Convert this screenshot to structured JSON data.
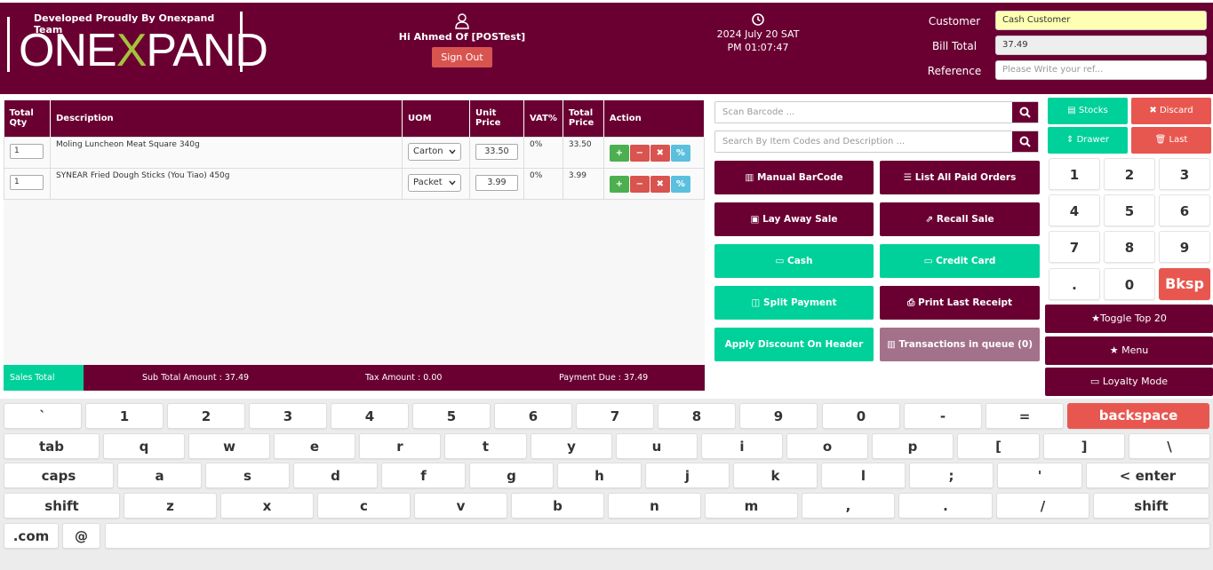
{
  "header": {
    "tagline": "Developed Proudly By Onexpand Team",
    "logo_pre": "ONE",
    "logo_x": "X",
    "logo_post": "PAND",
    "greeting": "Hi Ahmed Of [POSTest]",
    "sign_out": "Sign Out",
    "date": "2024 July 20 SAT",
    "time": "PM 01:07:47",
    "customer_label": "Customer",
    "customer_value": "Cash Customer",
    "bill_total_label": "Bill Total",
    "bill_total_value": "37.49",
    "reference_label": "Reference",
    "reference_placeholder": "Please Write your ref..."
  },
  "grid": {
    "headers": [
      "Total Qty",
      "Description",
      "UOM",
      "Unit Price",
      "VAT%",
      "Total Price",
      "Action"
    ],
    "rows": [
      {
        "qty": "1",
        "description": "Moling Luncheon Meat Square 340g",
        "uom": "Carton",
        "unit_price": "33.50",
        "vat": "0%",
        "total": "33.50"
      },
      {
        "qty": "1",
        "description": "SYNEAR Fried Dough Sticks (You Tiao) 450g",
        "uom": "Packet",
        "unit_price": "3.99",
        "vat": "0%",
        "total": "3.99"
      }
    ],
    "action_icons": [
      "plus-icon",
      "minus-icon",
      "remove-icon",
      "percent-icon"
    ]
  },
  "totals": {
    "sales_total": "Sales Total",
    "sub_total": "Sub Total Amount : 37.49",
    "tax": "Tax Amount : 0.00",
    "payment_due": "Payment Due : 37.49"
  },
  "search": {
    "barcode_placeholder": "Scan Barcode ...",
    "item_placeholder": "Search By Item Codes and Description ..."
  },
  "actions": {
    "manual_barcode": "Manual BarCode",
    "list_paid_orders": "List All Paid Orders",
    "lay_away": "Lay Away Sale",
    "recall_sale": "Recall Sale",
    "cash": "Cash",
    "credit_card": "Credit Card",
    "split_payment": "Split Payment",
    "print_last_receipt": "Print Last Receipt",
    "apply_discount": "Apply Discount On Header",
    "transactions_queue": "Transactions in queue (0)"
  },
  "side": {
    "stocks": "Stocks",
    "discard": "Discard",
    "drawer": "Drawer",
    "last": "Last",
    "numpad": [
      "1",
      "2",
      "3",
      "4",
      "5",
      "6",
      "7",
      "8",
      "9",
      ".",
      "0",
      "Bksp"
    ],
    "toggle_top": "Toggle Top 20",
    "menu": "Menu",
    "loyalty": "Loyalty Mode"
  },
  "keyboard": {
    "row1": [
      "`",
      "1",
      "2",
      "3",
      "4",
      "5",
      "6",
      "7",
      "8",
      "9",
      "0",
      "-",
      "=",
      "backspace"
    ],
    "row2": [
      "tab",
      "q",
      "w",
      "e",
      "r",
      "t",
      "y",
      "u",
      "i",
      "o",
      "p",
      "[",
      "]",
      "\\"
    ],
    "row3": [
      "caps",
      "a",
      "s",
      "d",
      "f",
      "g",
      "h",
      "j",
      "k",
      "l",
      ";",
      "'",
      "< enter"
    ],
    "row4": [
      "shift",
      "z",
      "x",
      "c",
      "v",
      "b",
      "n",
      "m",
      ",",
      ".",
      "/",
      "shift"
    ],
    "row5": [
      ".com",
      "@"
    ]
  },
  "colors": {
    "brand": "#6a0032",
    "accent_green": "#00d19a",
    "danger": "#e8574f",
    "logo_x": "#a5c23b"
  }
}
